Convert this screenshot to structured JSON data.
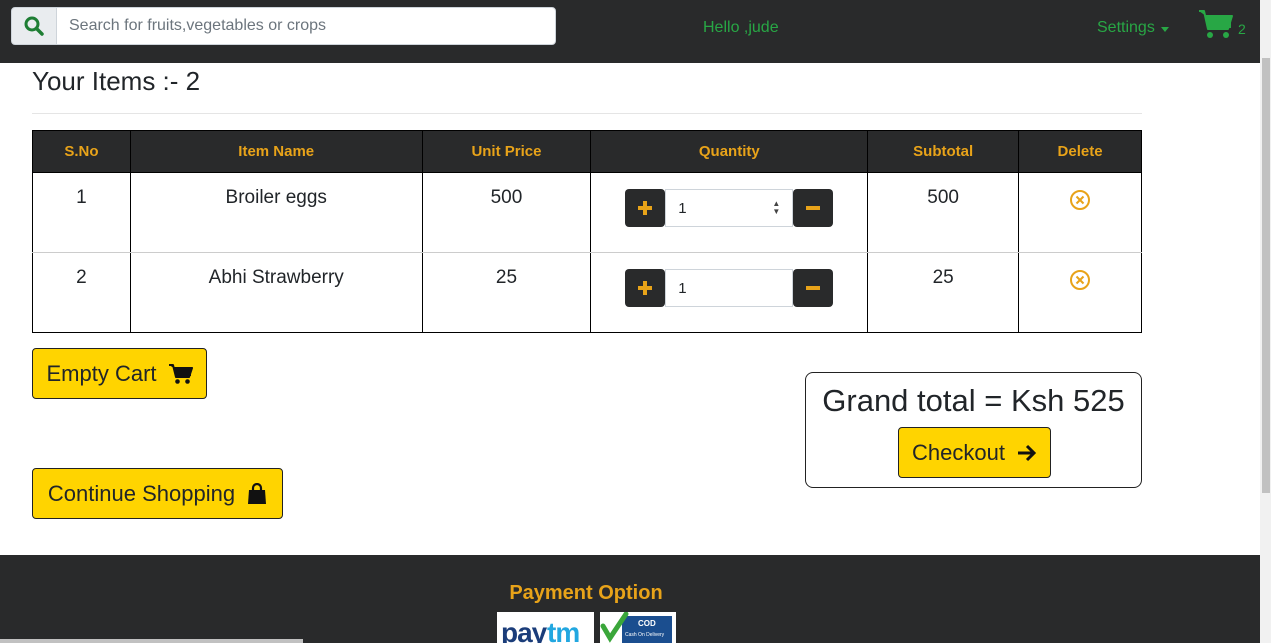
{
  "nav": {
    "search_placeholder": "Search for fruits,vegetables or crops",
    "greeting": "Hello ,jude",
    "settings_label": "Settings",
    "cart_count": "2"
  },
  "cart": {
    "title": "Your Items :- 2",
    "columns": [
      "S.No",
      "Item Name",
      "Unit Price",
      "Quantity",
      "Subtotal",
      "Delete"
    ],
    "rows": [
      {
        "sno": "1",
        "name": "Broiler eggs",
        "price": "500",
        "qty": "1",
        "subtotal": "500"
      },
      {
        "sno": "2",
        "name": "Abhi Strawberry",
        "price": "25",
        "qty": "1",
        "subtotal": "25"
      }
    ]
  },
  "actions": {
    "empty_cart": "Empty Cart",
    "continue_shopping": "Continue Shopping",
    "grand_total": "Grand total = Ksh 525",
    "checkout": "Checkout"
  },
  "footer": {
    "payment_title": "Payment Option",
    "paytm_logo": "Paytm",
    "cod_logo": "COD Cash On Delivery"
  },
  "colors": {
    "nav_bg": "#292a2b",
    "accent_green": "#28a745",
    "accent_gold": "#e8a319",
    "button_yellow": "#ffd400"
  }
}
